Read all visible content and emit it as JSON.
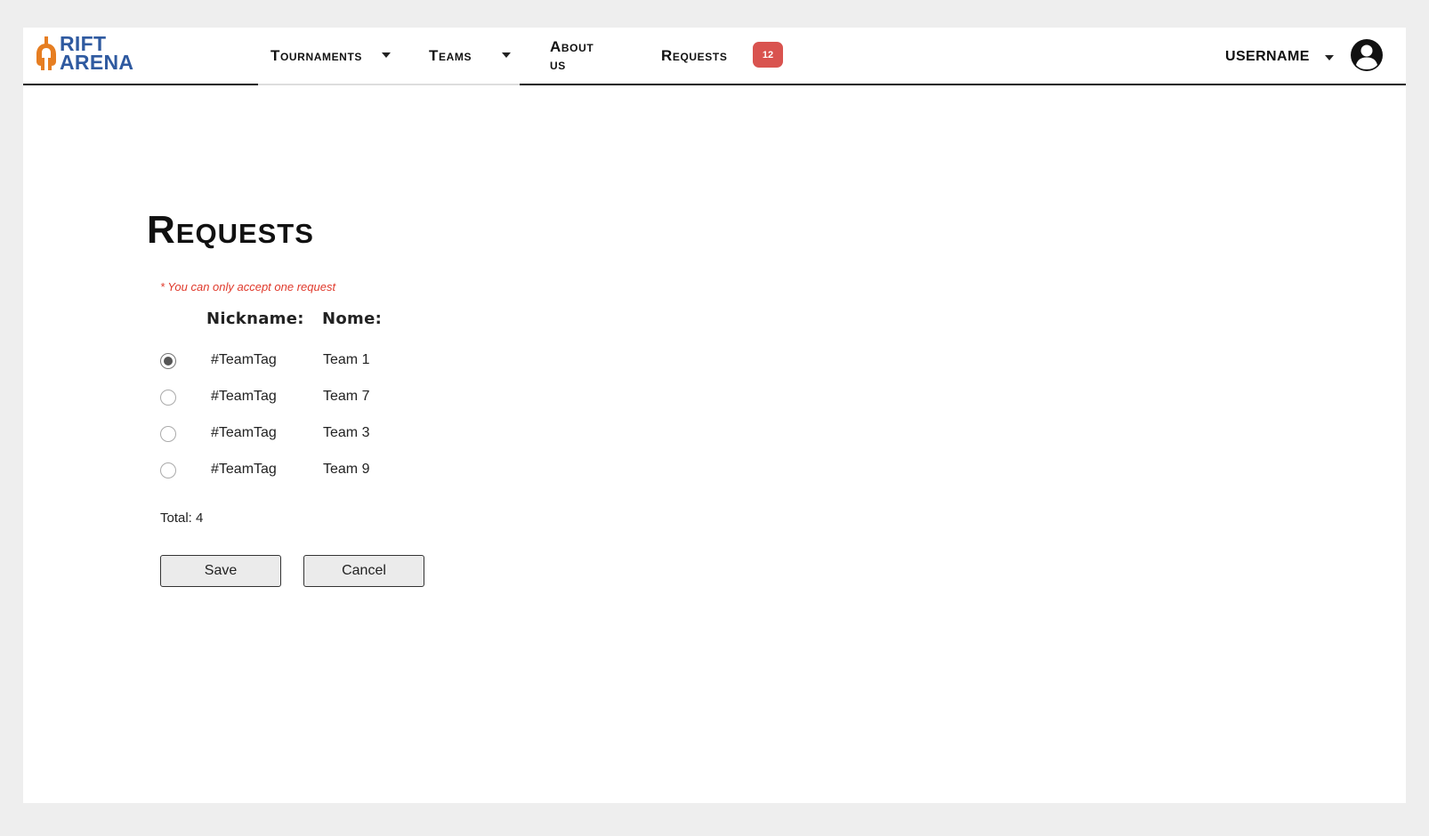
{
  "brand": {
    "line1": "RIFT",
    "line2": "ARENA",
    "orange": "#e67e22",
    "blue": "#2f5aa0"
  },
  "nav": {
    "tournaments": "Tournaments",
    "teams": "Teams",
    "about": "About us",
    "requests": "Requests",
    "requests_badge": "12"
  },
  "user": {
    "name": "USERNAME"
  },
  "page": {
    "title": "Requests",
    "note": "* You can only accept one request"
  },
  "table": {
    "headers": {
      "nickname": "Nickname:",
      "name": "Nome:"
    },
    "rows": [
      {
        "nickname": "#TeamTag",
        "name": "Team 1",
        "selected": true
      },
      {
        "nickname": "#TeamTag",
        "name": "Team 7",
        "selected": false
      },
      {
        "nickname": "#TeamTag",
        "name": "Team 3",
        "selected": false
      },
      {
        "nickname": "#TeamTag",
        "name": "Team 9",
        "selected": false
      }
    ]
  },
  "total": "Total: 4",
  "buttons": {
    "save": "Save",
    "cancel": "Cancel"
  },
  "colors": {
    "badge": "#d9534f",
    "note": "#e0392b"
  }
}
